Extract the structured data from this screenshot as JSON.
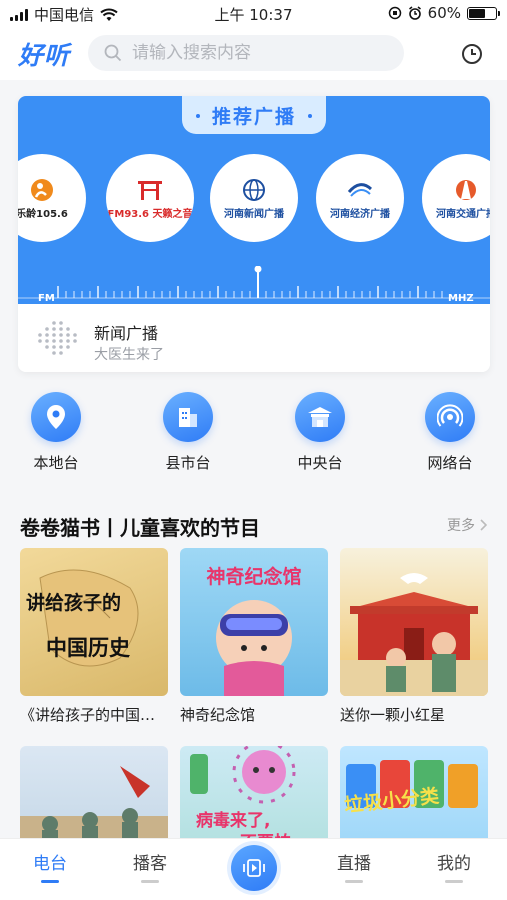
{
  "status_bar": {
    "carrier": "中国电信",
    "time": "上午 10:37",
    "battery": "60%",
    "battery_level": 0.6
  },
  "header": {
    "logo": "好听",
    "search_placeholder": "请输入搜索内容"
  },
  "broadcast": {
    "title": "推荐广播",
    "stations": [
      {
        "name": "乐龄105.6",
        "icon": "person-logo-icon"
      },
      {
        "name": "FM93.6 天籁之音",
        "icon": "gate-logo-icon"
      },
      {
        "name": "河南新闻广播",
        "icon": "globe-logo-icon"
      },
      {
        "name": "河南经济广播",
        "icon": "swirl-logo-icon"
      },
      {
        "name": "河南交通广播",
        "icon": "road-logo-icon"
      }
    ],
    "ruler_left": "FM",
    "ruler_right": "MHZ",
    "now_title": "新闻广播",
    "now_subtitle": "大医生来了"
  },
  "categories": [
    {
      "label": "本地台",
      "icon": "location-pin-icon"
    },
    {
      "label": "县市台",
      "icon": "building-icon"
    },
    {
      "label": "中央台",
      "icon": "palace-icon"
    },
    {
      "label": "网络台",
      "icon": "signal-tower-icon"
    }
  ],
  "section": {
    "title": "卷卷猫书丨儿童喜欢的节目",
    "more": "更多",
    "items": [
      {
        "name": "《讲给孩子的中国历史》",
        "cover_text": "讲给孩子的",
        "cover_text2": "中国历史"
      },
      {
        "name": "神奇纪念馆",
        "cover_text": "神奇纪念馆",
        "cover_text2": ""
      },
      {
        "name": "送你一颗小红星",
        "cover_text": "",
        "cover_text2": ""
      },
      {
        "name": "",
        "cover_text": "",
        "cover_text2": ""
      },
      {
        "name": "",
        "cover_text": "病毒来了,",
        "cover_text2": "不要怕"
      },
      {
        "name": "",
        "cover_text": "垃圾小分类",
        "cover_text2": ""
      }
    ]
  },
  "tabbar": {
    "tabs": [
      "电台",
      "播客",
      "直播",
      "我的"
    ],
    "active": 0
  },
  "colors": {
    "accent": "#2f7cf6",
    "banner": "#3a8ff5"
  }
}
